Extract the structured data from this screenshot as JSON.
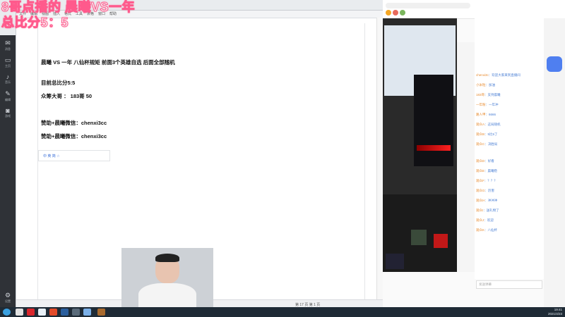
{
  "overlay": {
    "title": "8哥点播的 晨曦VS一年",
    "score": "总比分5：5"
  },
  "document": {
    "menu": [
      "文件",
      "编辑",
      "视图",
      "插入",
      "格式",
      "工具",
      "表格",
      "窗口",
      "帮助"
    ],
    "lines": [
      "晨曦 VS 一年 八仙杯规矩 前面3个英雄自选 后面全部随机",
      "目前总比分5:5",
      "众筹大哥 ： 183哥  50",
      "赞助+晨曦微信：chenxi3cc",
      "赞助+晨曦微信：chenxi3cc"
    ],
    "ime_bar": "中  英  简  ☆",
    "status": "第 17 页  第 1 页"
  },
  "left_nav": [
    {
      "icon": "✉",
      "label": "消息"
    },
    {
      "icon": "▭",
      "label": "主页"
    },
    {
      "icon": "♪",
      "label": "音乐"
    },
    {
      "icon": "✎",
      "label": "编辑"
    },
    {
      "icon": "◙",
      "label": "游戏"
    },
    {
      "icon": "⚙",
      "label": "设置"
    }
  ],
  "browser": {
    "chat": [
      {
        "user": "chenxi3c",
        "text": "：欢迎大家来到直播间"
      },
      {
        "user": "小米粒",
        "text": "：加油"
      },
      {
        "user": "183哥",
        "text": "：支持晨曦"
      },
      {
        "user": "一年粉",
        "text": "：一年冲"
      },
      {
        "user": "路人甲",
        "text": "：6666"
      },
      {
        "user": "观众A",
        "text": "：这局随机"
      },
      {
        "user": "观众B",
        "text": "：5比5了"
      },
      {
        "user": "观众C",
        "text": "：决胜局"
      },
      {
        "user": "观众D",
        "text": "：好看"
      },
      {
        "user": "观众E",
        "text": "：晨曦稳"
      },
      {
        "user": "观众F",
        "text": "：？？？"
      },
      {
        "user": "观众G",
        "text": "：厉害"
      },
      {
        "user": "观众H",
        "text": "：冲冲冲"
      },
      {
        "user": "观众I",
        "text": "：送礼物了"
      },
      {
        "user": "观众J",
        "text": "：欢迎"
      },
      {
        "user": "观众K",
        "text": "：八仙杯"
      }
    ],
    "input_placeholder": "发送弹幕"
  },
  "taskbar": {
    "time": "19:41",
    "date": "2021/4/23"
  }
}
